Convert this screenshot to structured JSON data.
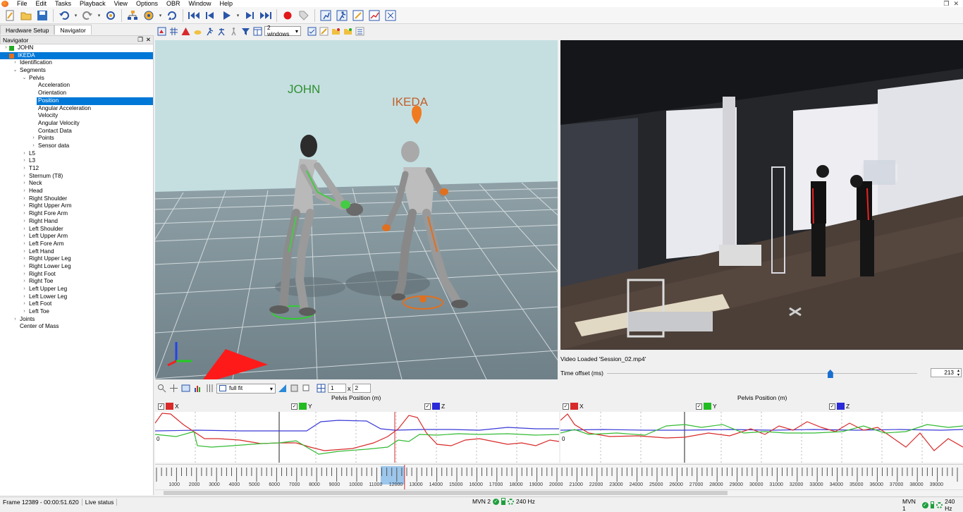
{
  "menu": [
    "File",
    "Edit",
    "Tasks",
    "Playback",
    "View",
    "Options",
    "OBR",
    "Window",
    "Help"
  ],
  "toolbar_icons": [
    "new-file-icon",
    "open-folder-icon",
    "save-icon",
    "undo-icon",
    "redo-icon",
    "refresh-icon",
    "hierarchy-icon",
    "globe-icon",
    "sync-icon",
    "skip-start-icon",
    "step-back-icon",
    "play-icon",
    "step-forward-icon",
    "skip-end-icon",
    "record-icon",
    "tag-icon",
    "runner-chart-icon",
    "runner-icon",
    "edit-icon",
    "chart-icon",
    "expand-icon"
  ],
  "tabs": {
    "hardware": "Hardware Setup",
    "navigator": "Navigator"
  },
  "navigator_title": "Navigator",
  "tree": [
    {
      "label": "JOHN",
      "level": 0,
      "arrow": "›",
      "color": "#22aa22"
    },
    {
      "label": "IKEDA",
      "level": 0,
      "arrow": "⌄",
      "color": "#e07020",
      "selected": true
    },
    {
      "label": "Identification",
      "level": 1,
      "arrow": "›"
    },
    {
      "label": "Segments",
      "level": 1,
      "arrow": "⌄"
    },
    {
      "label": "Pelvis",
      "level": 2,
      "arrow": "⌄"
    },
    {
      "label": "Acceleration",
      "level": 3
    },
    {
      "label": "Orientation",
      "level": 3
    },
    {
      "label": "Position",
      "level": 3,
      "highlight": true
    },
    {
      "label": "Angular Acceleration",
      "level": 3
    },
    {
      "label": "Velocity",
      "level": 3
    },
    {
      "label": "Angular Velocity",
      "level": 3
    },
    {
      "label": "Contact Data",
      "level": 3
    },
    {
      "label": "Points",
      "level": 3,
      "arrow": "›"
    },
    {
      "label": "Sensor data",
      "level": 3,
      "arrow": "›"
    },
    {
      "label": "L5",
      "level": 2,
      "arrow": "›"
    },
    {
      "label": "L3",
      "level": 2,
      "arrow": "›"
    },
    {
      "label": "T12",
      "level": 2,
      "arrow": "›"
    },
    {
      "label": "Sternum (T8)",
      "level": 2,
      "arrow": "›"
    },
    {
      "label": "Neck",
      "level": 2,
      "arrow": "›"
    },
    {
      "label": "Head",
      "level": 2,
      "arrow": "›"
    },
    {
      "label": "Right Shoulder",
      "level": 2,
      "arrow": "›"
    },
    {
      "label": "Right Upper Arm",
      "level": 2,
      "arrow": "›"
    },
    {
      "label": "Right Fore Arm",
      "level": 2,
      "arrow": "›"
    },
    {
      "label": "Right Hand",
      "level": 2,
      "arrow": "›"
    },
    {
      "label": "Left Shoulder",
      "level": 2,
      "arrow": "›"
    },
    {
      "label": "Left Upper Arm",
      "level": 2,
      "arrow": "›"
    },
    {
      "label": "Left Fore Arm",
      "level": 2,
      "arrow": "›"
    },
    {
      "label": "Left Hand",
      "level": 2,
      "arrow": "›"
    },
    {
      "label": "Right Upper Leg",
      "level": 2,
      "arrow": "›"
    },
    {
      "label": "Right Lower Leg",
      "level": 2,
      "arrow": "›"
    },
    {
      "label": "Right Foot",
      "level": 2,
      "arrow": "›"
    },
    {
      "label": "Right Toe",
      "level": 2,
      "arrow": "›"
    },
    {
      "label": "Left Upper Leg",
      "level": 2,
      "arrow": "›"
    },
    {
      "label": "Left Lower Leg",
      "level": 2,
      "arrow": "›"
    },
    {
      "label": "Left Foot",
      "level": 2,
      "arrow": "›"
    },
    {
      "label": "Left Toe",
      "level": 2,
      "arrow": "›"
    },
    {
      "label": "Joints",
      "level": 1,
      "arrow": "›"
    },
    {
      "label": "Center of Mass",
      "level": 1
    }
  ],
  "viewbar": {
    "windows_label": "2 windows"
  },
  "scene": {
    "actor1": "JOHN",
    "actor2": "IKEDA",
    "actor1_color": "#2f8f2f",
    "actor2_color": "#c2602a"
  },
  "video": {
    "status": "Video Loaded 'Session_02.mp4'",
    "offset_label": "Time offset (ms)",
    "offset_value": "213",
    "offset_fraction": 0.72
  },
  "graphbar": {
    "fit_label": "full fit",
    "rows": "1",
    "times": "x",
    "cols": "2"
  },
  "graphs": [
    {
      "title": "Pelvis Position (m)",
      "zero": "0",
      "legend": [
        {
          "label": "X",
          "color": "#d82a2a"
        },
        {
          "label": "Y",
          "color": "#22bb22"
        },
        {
          "label": "Z",
          "color": "#2a2ad8"
        }
      ]
    },
    {
      "title": "Pelvis Position (m)",
      "zero": "0",
      "legend": [
        {
          "label": "X",
          "color": "#d82a2a"
        },
        {
          "label": "Y",
          "color": "#22bb22"
        },
        {
          "label": "Z",
          "color": "#2a2ad8"
        }
      ]
    }
  ],
  "timeline": {
    "labels": [
      "1000",
      "2000",
      "3000",
      "4000",
      "5000",
      "6000",
      "7000",
      "8000",
      "9000",
      "10000",
      "11000",
      "12000",
      "13000",
      "14000",
      "15000",
      "16000",
      "17000",
      "18000",
      "19000",
      "20000",
      "21000",
      "22000",
      "23000",
      "24000",
      "25000",
      "26000",
      "27000",
      "28000",
      "29000",
      "30000",
      "31000",
      "32000",
      "33000",
      "34000",
      "35000",
      "36000",
      "37000",
      "38000",
      "39000"
    ],
    "current_frame": 12389,
    "max_frame": 40000
  },
  "status": {
    "frame": "Frame 12389 - 00:00:51.620",
    "live": "Live status",
    "mvn2": "MVN 2",
    "mvn1": "MVN 1",
    "hz": "240 Hz"
  }
}
